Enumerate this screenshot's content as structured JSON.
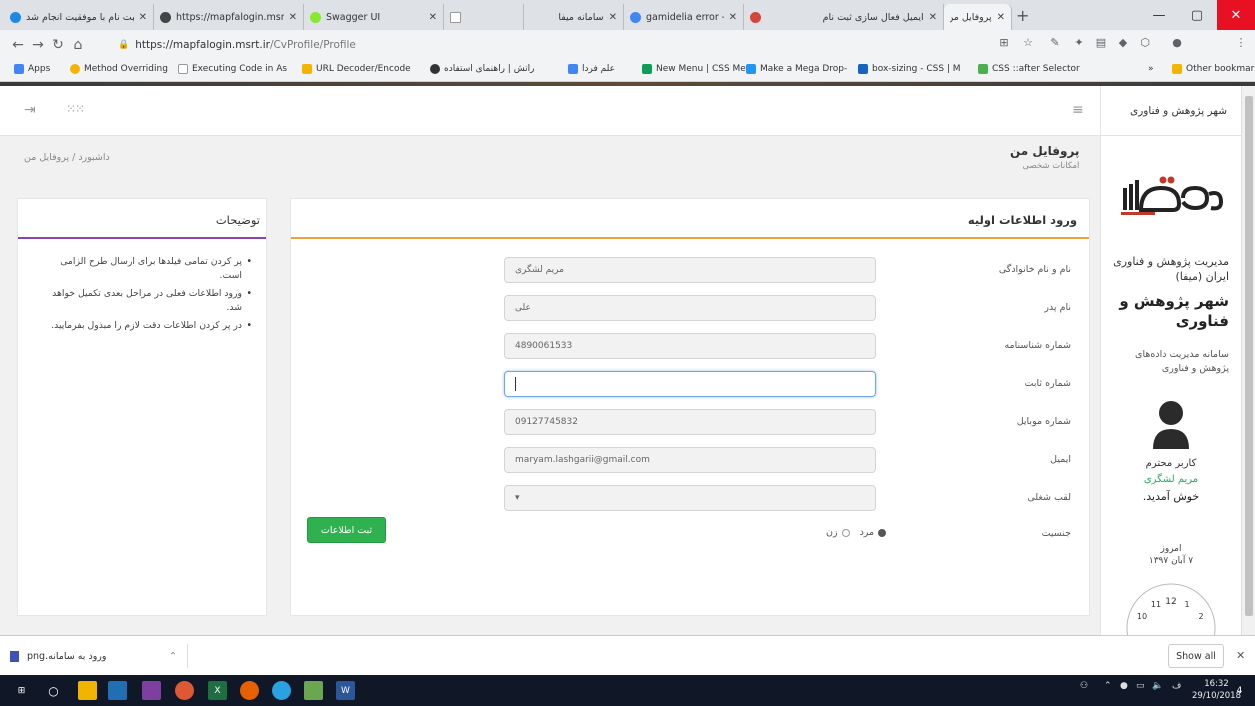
{
  "browser": {
    "tabs": [
      {
        "title": "ثبت نام با موفقیت انجام شد",
        "favicon": "#1e88e5"
      },
      {
        "title": "https://mapfalogin.msrt.ir",
        "favicon": "#444444"
      },
      {
        "title": "Swagger UI",
        "favicon": "#85ea2d"
      },
      {
        "title": "",
        "favicon": "#e8e8e8"
      },
      {
        "title": "سامانه میفا",
        "favicon": "#cccccc"
      },
      {
        "title": "gamidelia error - Google",
        "favicon": "#4285f4"
      },
      {
        "title": "ایمیل فعال سازی ثبت نام",
        "favicon": "#d44638"
      },
      {
        "title": "پروفایل من",
        "favicon": "#1e88e5"
      }
    ],
    "url_host": "https://mapfalogin.msrt.ir",
    "url_path": "/CvProfile/Profile",
    "bookmarks": [
      {
        "label": "Apps",
        "color": "#4285f4"
      },
      {
        "label": "Method Overriding",
        "color": "#f4b400"
      },
      {
        "label": "Executing Code in As",
        "color": "#cccccc"
      },
      {
        "label": "URL Decoder/Encode",
        "color": "#f4b400"
      },
      {
        "label": "راتش | راهنمای استفاده",
        "color": "#333333"
      },
      {
        "label": "علم فردا",
        "color": "#4285f4"
      },
      {
        "label": "New Menu | CSS Men",
        "color": "#0f9d58"
      },
      {
        "label": "Make a Mega Drop-",
        "color": "#2196f3"
      },
      {
        "label": "box-sizing - CSS | M",
        "color": "#1565c0"
      },
      {
        "label": "CSS ::after Selector",
        "color": "#4caf50"
      }
    ],
    "other_bookmarks": "Other bookmarks",
    "overflow": "»"
  },
  "sidebar": {
    "header": "شهر پژوهش و فناوری",
    "org_name": "مدیریت پژوهش و فناوری ایران (میفا)",
    "city_title": "شهر پژوهش و فناوری",
    "system_desc": "سامانه مدیریت داده‌های پژوهش و فناوری",
    "user_greeting": "کاربر محترم",
    "user_name": "مریم لشگری",
    "welcome": "خوش آمدید.",
    "today_label": "امروز",
    "today_date": "۷ آبان ۱۳۹۷"
  },
  "page": {
    "title": "پروفایل من",
    "subtitle": "امکانات شخصی",
    "breadcrumb": "داشبورد / پروفایل من"
  },
  "form": {
    "heading": "ورود اطلاعات اولیه",
    "fields": [
      {
        "label": "نام و نام خانوادگی",
        "value": "مریم لشگری",
        "rtl": true
      },
      {
        "label": "نام پدر",
        "value": "علی",
        "rtl": true
      },
      {
        "label": "شماره شناسنامه",
        "value": "4890061533",
        "rtl": false
      },
      {
        "label": "شماره ثابت",
        "value": "",
        "rtl": false
      },
      {
        "label": "شماره موبایل",
        "value": "09127745832",
        "rtl": false
      },
      {
        "label": "ایمیل",
        "value": "maryam.lashgarii@gmail.com",
        "rtl": false
      },
      {
        "label": "لقب شغلی",
        "value": "▾",
        "rtl": false
      }
    ],
    "gender_label": "جنسیت",
    "gender_male": "مرد",
    "gender_female": "زن",
    "submit_label": "ثبت اطلاعات"
  },
  "notes": {
    "heading": "توضیحات",
    "items": [
      "پر کردن تمامی فیلدها برای ارسال طرح الزامی است.",
      "ورود اطلاعات فعلی در مراحل بعدی تکمیل خواهد شد.",
      "در پر کردن اطلاعات دقت لازم را مبذول بفرمایید."
    ]
  },
  "downloads": {
    "file": "ورود به سامانه.png",
    "show_all": "Show all"
  },
  "taskbar": {
    "time": "16:32",
    "date": "29/10/2018",
    "notify_count": "4"
  },
  "colors": {
    "accent_orange": "#e8a33b",
    "accent_purple": "#8e44ad",
    "submit_green": "#2fb14f",
    "welcome_green": "#27ae60"
  }
}
